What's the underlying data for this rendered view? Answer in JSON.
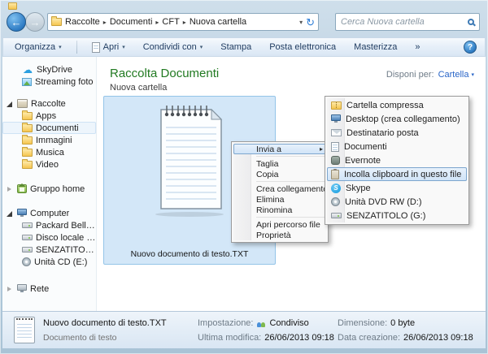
{
  "colors": {
    "aero_frame": "#b9cfe0",
    "title_green": "#217a21",
    "selection_fill": "#d3e7f8",
    "selection_border": "#94c4e8",
    "menu_highlight_border": "#7da6ce",
    "link_blue": "#2a66c8"
  },
  "icons": {
    "back": "←",
    "forward": "→",
    "refresh": "↻",
    "dropdown": "▾",
    "crumb_sep": "▸",
    "submenu_arrow": "▸",
    "overflow": "»",
    "help": "?",
    "cloud": "☁",
    "skype_s": "S"
  },
  "breadcrumb": {
    "segments": [
      "Raccolte",
      "Documenti",
      "CFT",
      "Nuova cartella"
    ]
  },
  "search": {
    "placeholder": "Cerca Nuova cartella"
  },
  "toolbar": {
    "organizza": "Organizza",
    "apri": "Apri",
    "condividi": "Condividi con",
    "stampa": "Stampa",
    "posta": "Posta elettronica",
    "masterizza": "Masterizza"
  },
  "sidebar": {
    "items": [
      {
        "label": "SkyDrive"
      },
      {
        "label": "Streaming foto"
      },
      {
        "label": "Raccolte"
      },
      {
        "label": "Apps"
      },
      {
        "label": "Documenti"
      },
      {
        "label": "Immagini"
      },
      {
        "label": "Musica"
      },
      {
        "label": "Video"
      },
      {
        "label": "Gruppo home"
      },
      {
        "label": "Computer"
      },
      {
        "label": "Packard Bell (C:)"
      },
      {
        "label": "Disco locale (D:)"
      },
      {
        "label": "SENZATITOLO (G:)"
      },
      {
        "label": "Unità CD (E:)"
      },
      {
        "label": "Rete"
      }
    ]
  },
  "main": {
    "title": "Raccolta Documenti",
    "subtitle": "Nuova cartella",
    "arrange_label": "Disponi per:",
    "arrange_value": "Cartella",
    "file_label": "Nuovo documento di testo.TXT"
  },
  "context_menu": {
    "items": [
      "Invia a",
      "Taglia",
      "Copia",
      "Crea collegamento",
      "Elimina",
      "Rinomina",
      "Apri percorso file",
      "Proprietà"
    ]
  },
  "send_to_menu": {
    "items": [
      "Cartella compressa",
      "Desktop (crea collegamento)",
      "Destinatario posta",
      "Documenti",
      "Evernote",
      "Incolla clipboard in questo file",
      "Skype",
      "Unità DVD RW (D:)",
      "SENZATITOLO (G:)"
    ]
  },
  "details": {
    "filename": "Nuovo documento di testo.TXT",
    "filetype": "Documento di testo",
    "setting_label": "Impostazione:",
    "setting_value": "Condiviso",
    "modified_label": "Ultima modifica:",
    "modified_value": "26/06/2013 09:18",
    "size_label": "Dimensione:",
    "size_value": "0 byte",
    "created_label": "Data creazione:",
    "created_value": "26/06/2013 09:18"
  }
}
